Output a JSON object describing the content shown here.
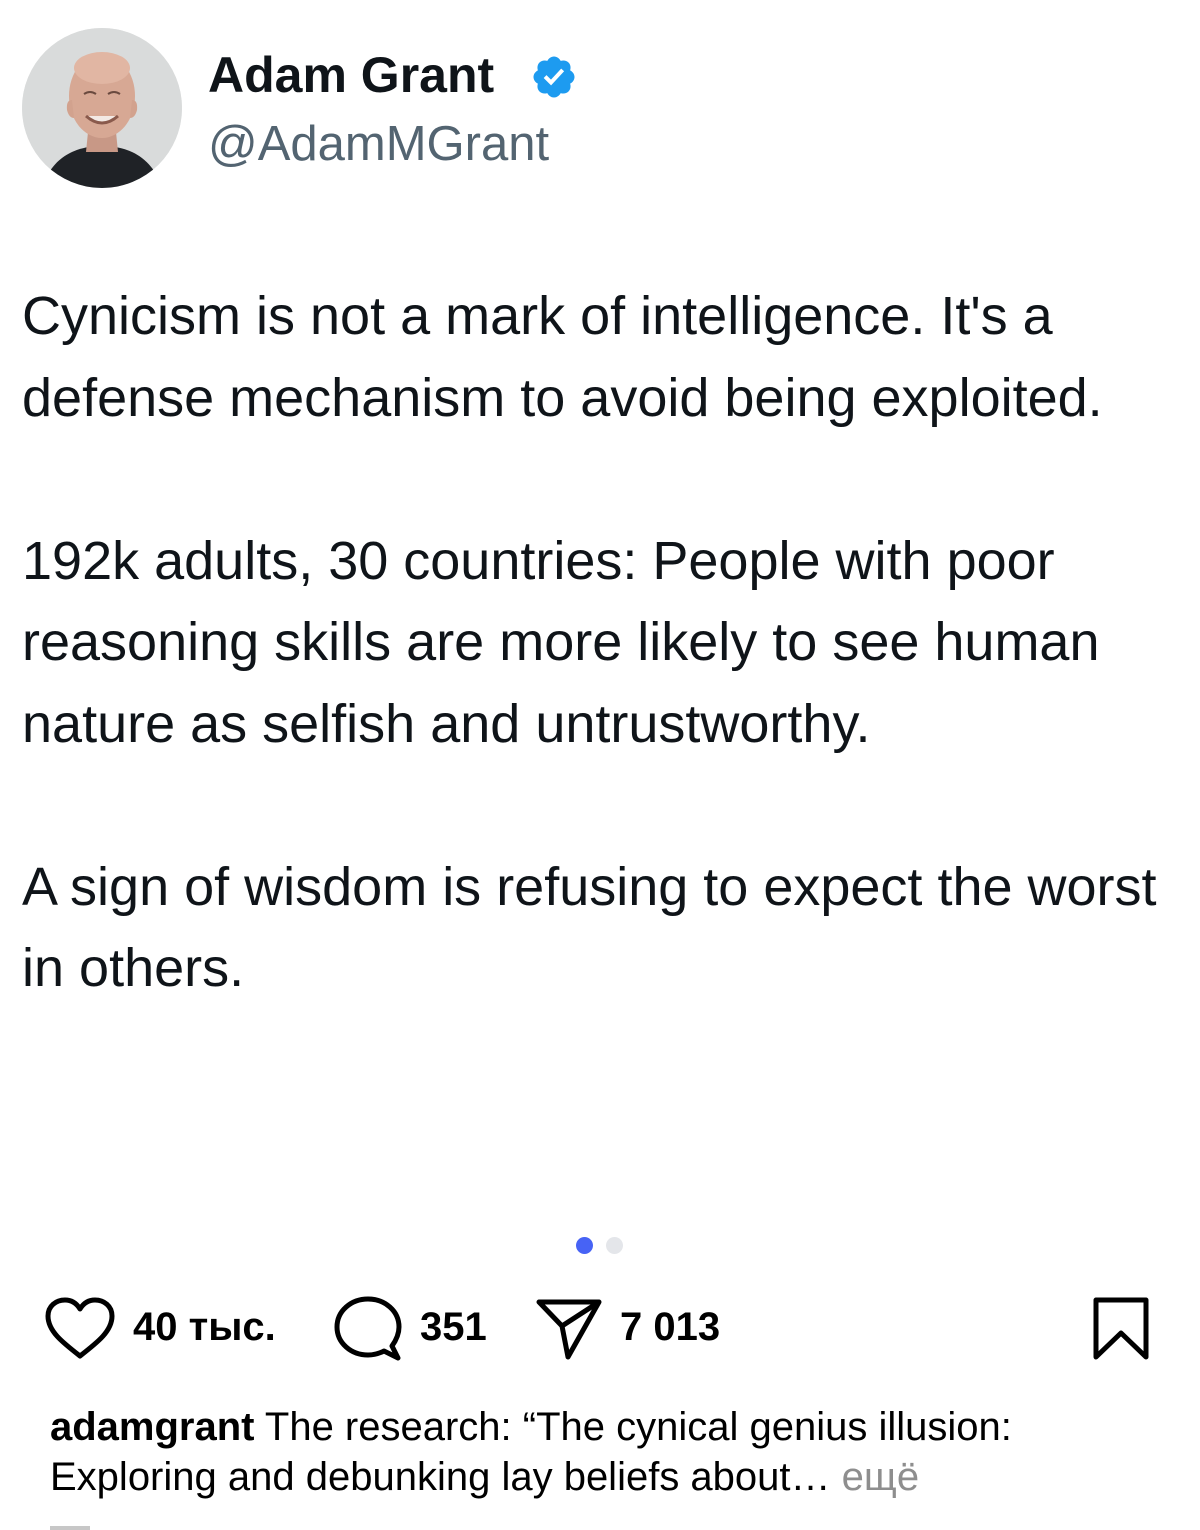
{
  "tweet": {
    "author_name": "Adam Grant",
    "handle": "@AdamMGrant",
    "paragraphs": [
      "Cynicism is not a mark of intelligence. It's a defense mechanism to avoid being exploited.",
      "192k adults, 30 countries: People with poor reasoning skills are more likely to see human nature as selfish and untrustworthy.",
      "A sign of wisdom is refusing to expect the worst in others."
    ]
  },
  "carousel": {
    "current": 1,
    "total": 2
  },
  "actions": {
    "likes": "40 тыс.",
    "comments": "351",
    "shares": "7 013"
  },
  "caption": {
    "username": "adamgrant",
    "text": "The research: “The cynical genius illusion: Exploring and debunking lay beliefs about…",
    "more": "ещё"
  },
  "colors": {
    "verified_badge": "#1d9bf0",
    "pager_active": "#4763f5",
    "pager_inactive": "#e4e6ea",
    "text_primary": "#0f1419",
    "text_secondary": "#536471",
    "more_link": "#8e8e8e"
  },
  "icons": {
    "like": "heart-icon",
    "comment": "comment-bubble-icon",
    "share": "paper-plane-icon",
    "save": "bookmark-icon",
    "verified": "verified-badge-icon"
  }
}
